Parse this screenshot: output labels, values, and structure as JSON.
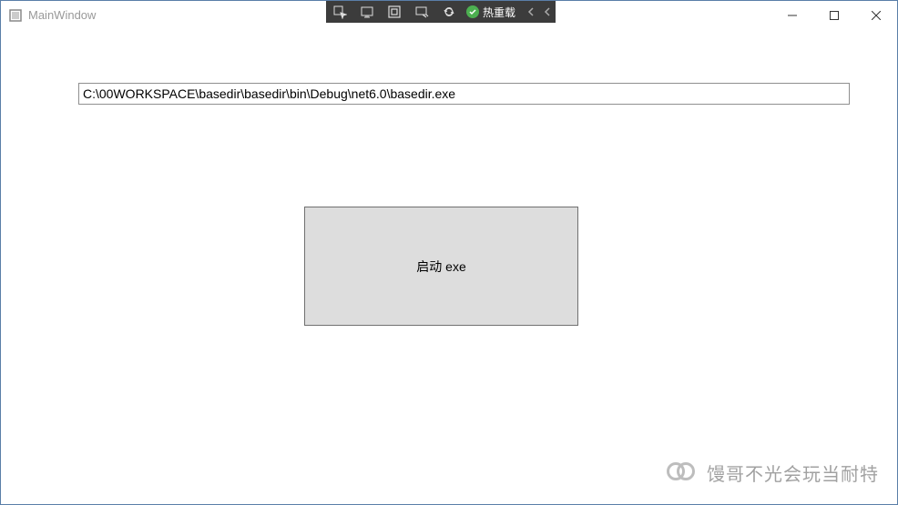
{
  "window": {
    "title": "MainWindow"
  },
  "vs_toolbar": {
    "hot_reload_label": "热重载"
  },
  "content": {
    "path_value": "C:\\00WORKSPACE\\basedir\\basedir\\bin\\Debug\\net6.0\\basedir.exe",
    "launch_label": "启动 exe"
  },
  "watermark": {
    "text": "馒哥不光会玩当耐特"
  }
}
